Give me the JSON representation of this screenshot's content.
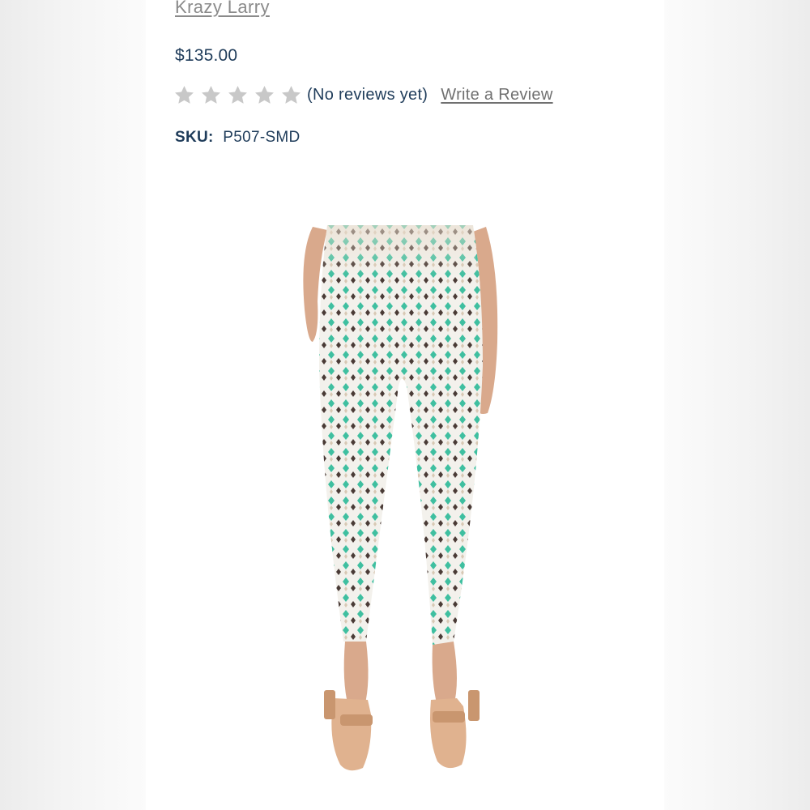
{
  "product": {
    "brand": "Krazy Larry",
    "price": "$135.00",
    "rating": {
      "stars_filled": 0,
      "stars_total": 5,
      "reviews_text": "(No reviews yet)",
      "write_review_label": "Write a Review"
    },
    "sku": {
      "label": "SKU:",
      "value": "P507-SMD"
    },
    "image_icon": "product-photo"
  },
  "colors": {
    "text_primary": "#1f3c5a",
    "link": "#707070",
    "star_empty": "#c8c8c8",
    "pattern_teal": "#3fbfa0",
    "pattern_brown": "#4a3b36",
    "pattern_beige": "#d8c8b4"
  }
}
